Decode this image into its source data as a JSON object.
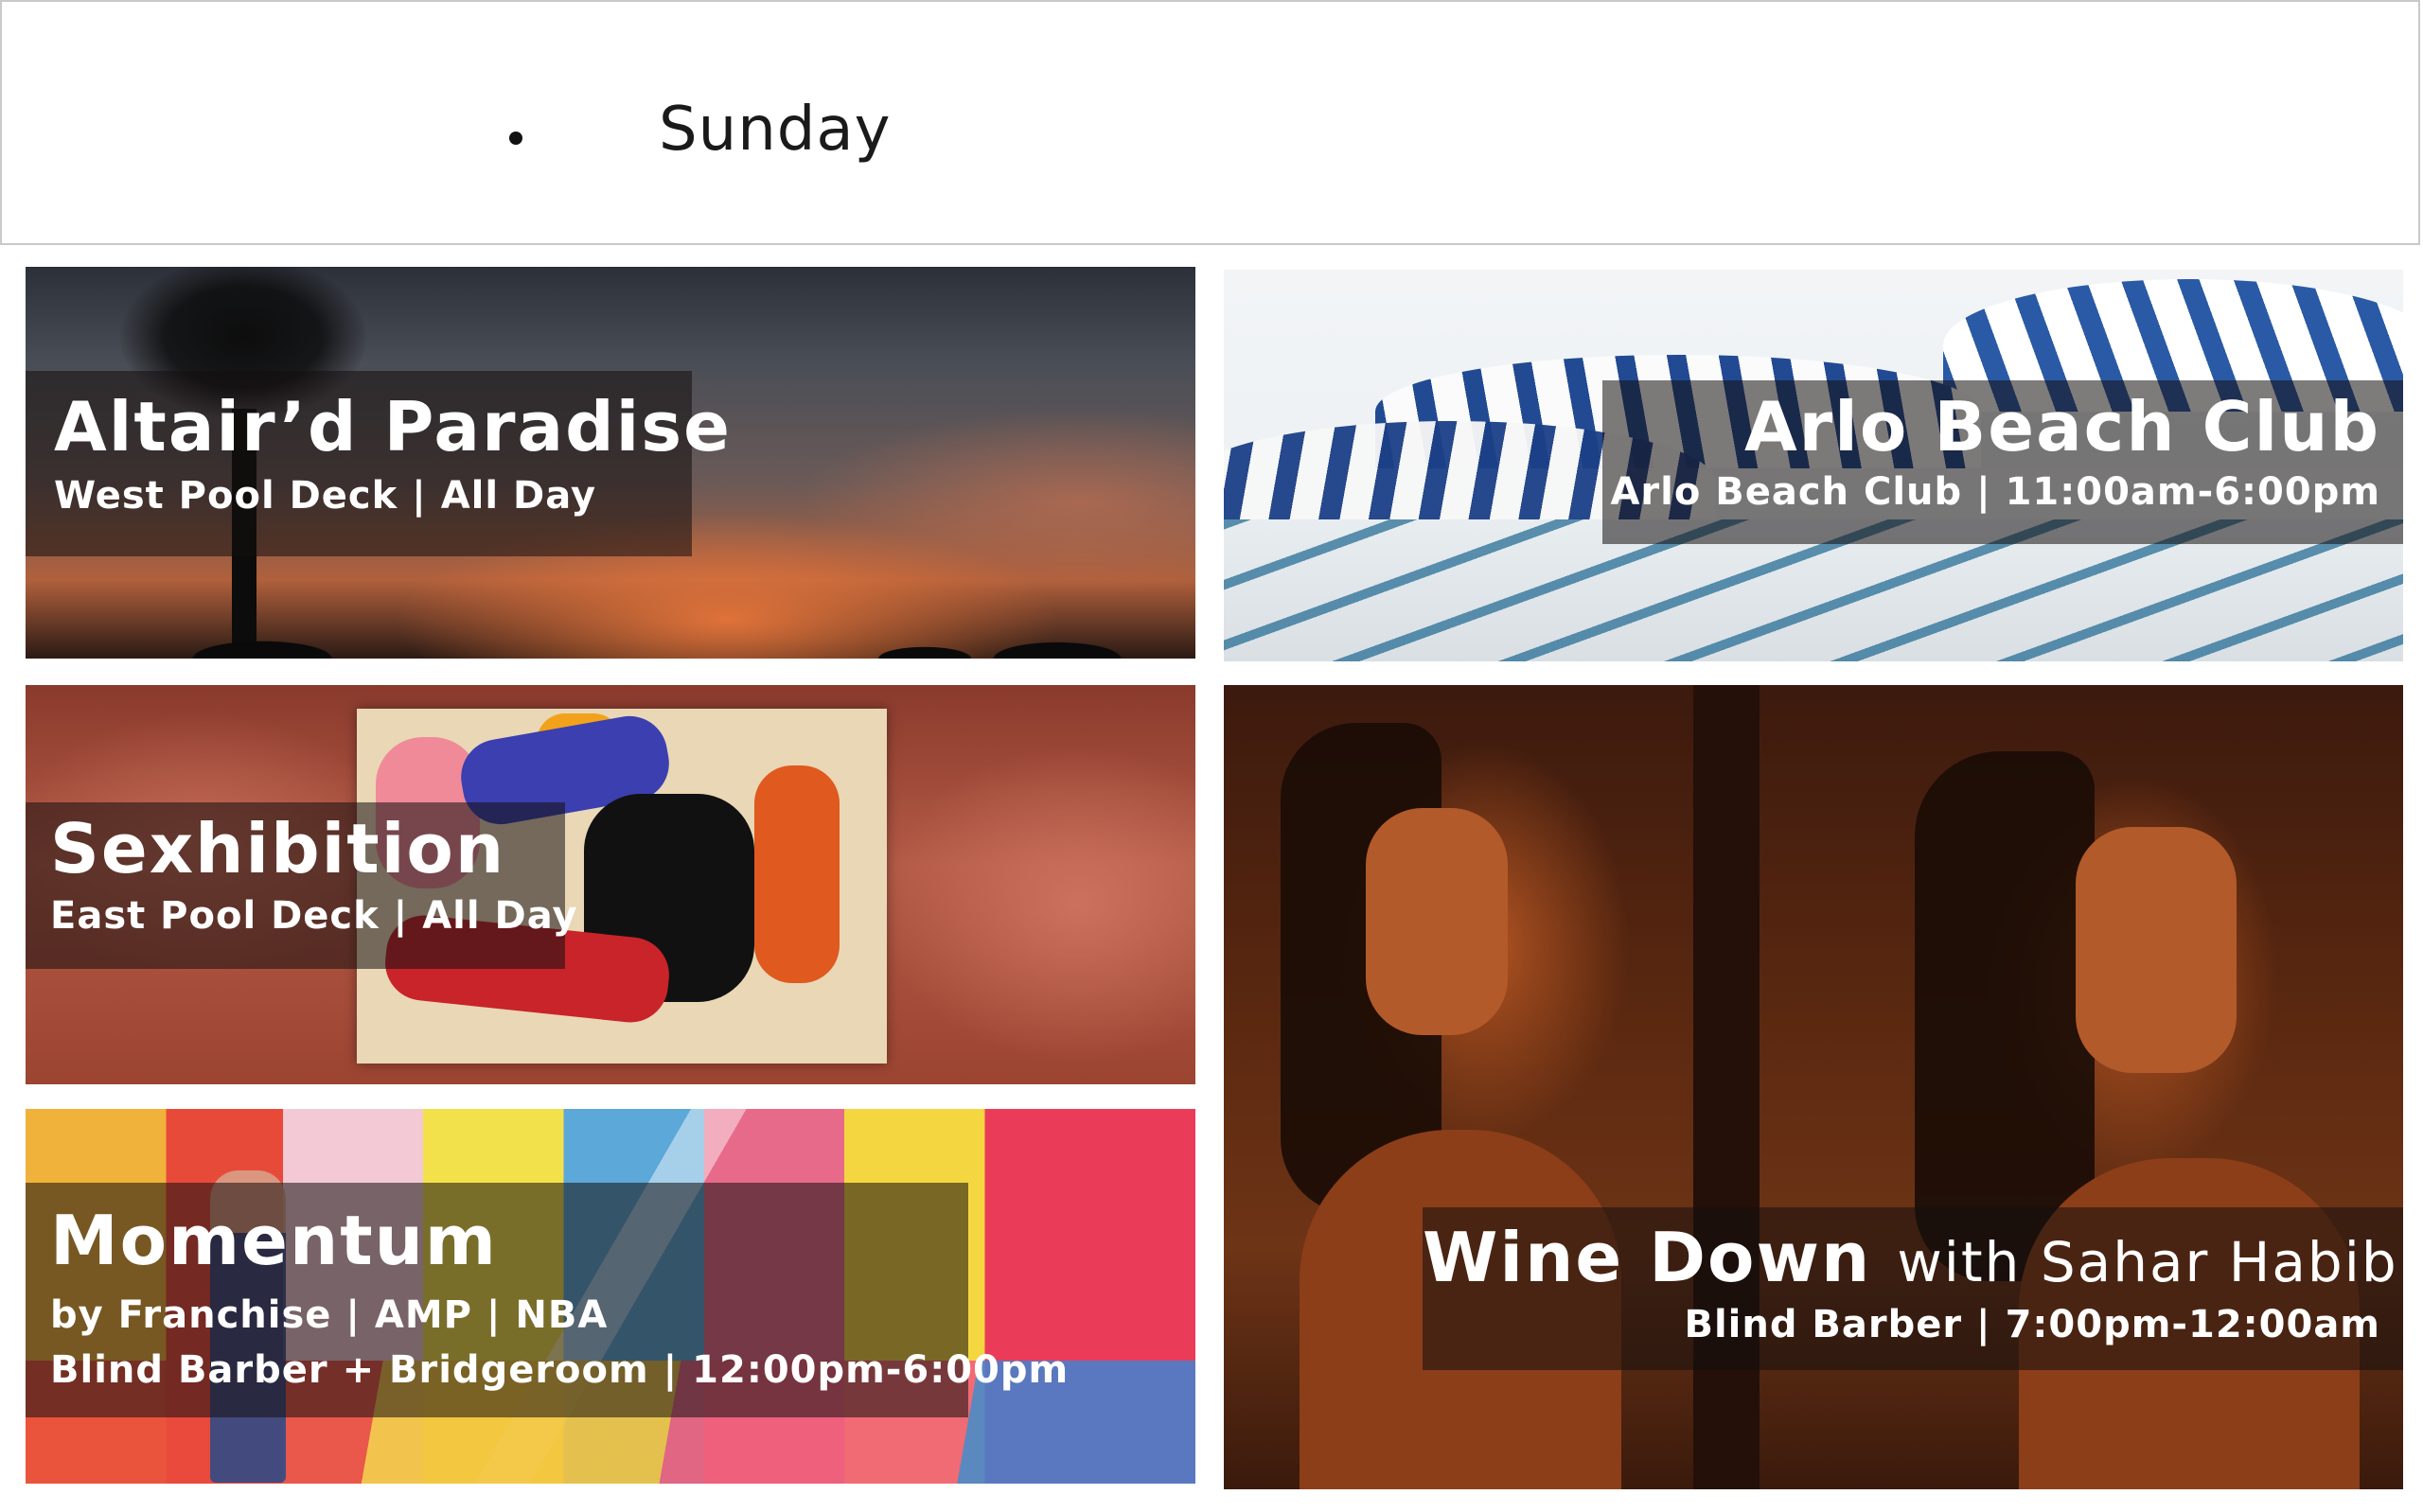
{
  "header": {
    "day": "Sunday"
  },
  "events": [
    {
      "title": "Altair’d Paradise",
      "subtitle": "West Pool Deck | All Day"
    },
    {
      "title": "Arlo Beach Club",
      "subtitle": "Arlo Beach Club | 11:00am-6:00pm"
    },
    {
      "title": "Sexhibition",
      "subtitle": "East Pool Deck | All Day"
    },
    {
      "title": "Momentum",
      "subtitle": "by Franchise | AMP | NBA",
      "subtitle2": "Blind Barber + Bridgeroom | 12:00pm-6:00pm"
    },
    {
      "title": "Wine Down",
      "title_suffix": "with Sahar Habibi",
      "subtitle": "Blind Barber | 7:00pm-12:00am"
    }
  ]
}
